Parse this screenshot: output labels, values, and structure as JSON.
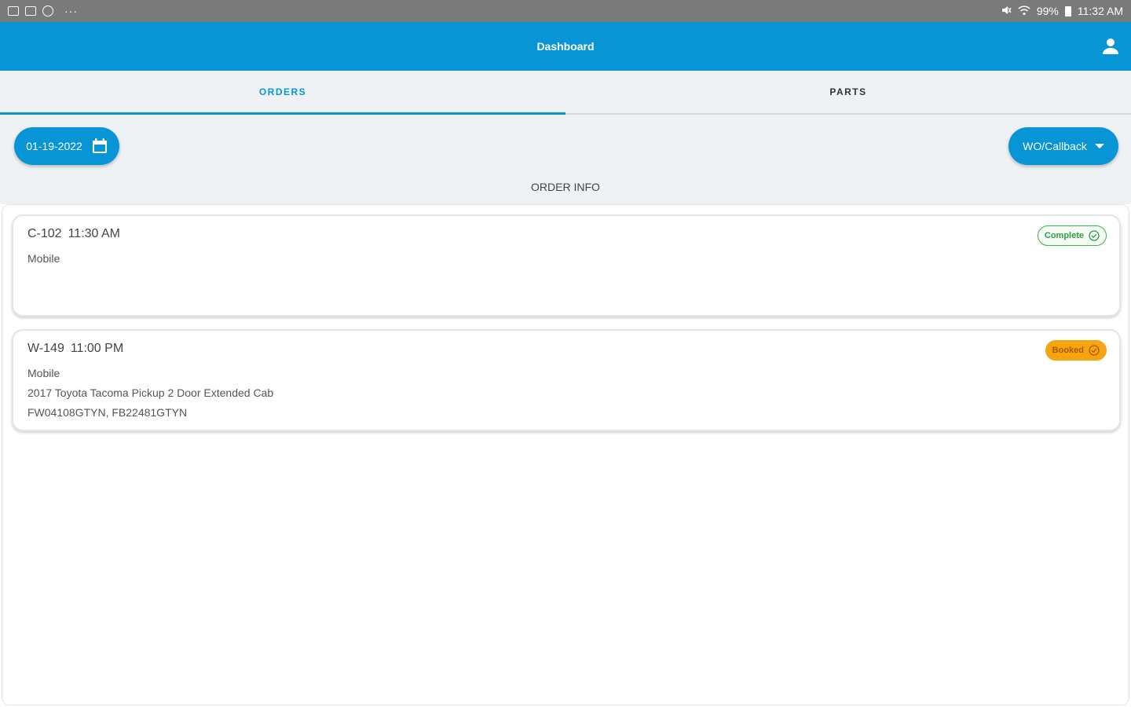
{
  "status_bar": {
    "battery": "99%",
    "time": "11:32 AM"
  },
  "appbar": {
    "title": "Dashboard"
  },
  "tabs": [
    {
      "label": "ORDERS",
      "active": true
    },
    {
      "label": "PARTS",
      "active": false
    }
  ],
  "toolbar": {
    "date": "01-19-2022",
    "filter": "WO/Callback",
    "section_title": "ORDER INFO"
  },
  "orders": [
    {
      "id": "C-102",
      "time": "11:30 AM",
      "type": "Mobile",
      "vehicle": "",
      "parts": "",
      "status": "Complete"
    },
    {
      "id": "W-149",
      "time": "11:00 PM",
      "type": "Mobile",
      "vehicle": "2017 Toyota Tacoma Pickup 2 Door Extended Cab",
      "parts": "FW04108GTYN, FB22481GTYN",
      "status": "Booked"
    }
  ],
  "colors": {
    "primary": "#0795d6",
    "complete": "#36b54a",
    "booked": "#f5a50f"
  }
}
